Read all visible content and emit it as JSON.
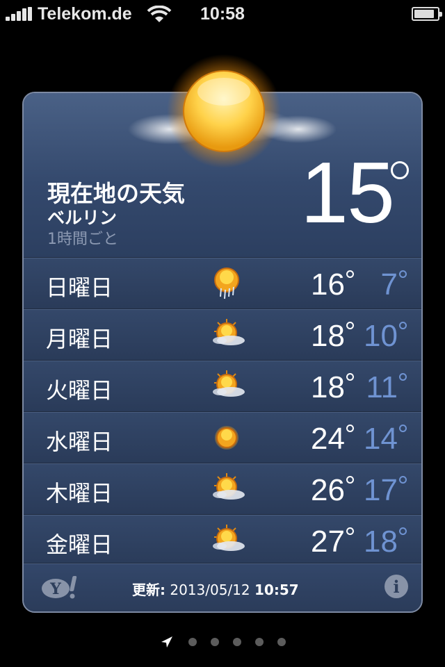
{
  "status_bar": {
    "carrier": "Telekom.de",
    "time": "10:58"
  },
  "current": {
    "title": "現在地の天気",
    "city": "ベルリン",
    "interval": "1時間ごと",
    "temperature": "15"
  },
  "forecast": [
    {
      "day": "日曜日",
      "icon": "sun-rain-icon",
      "high": "16",
      "low": "7"
    },
    {
      "day": "月曜日",
      "icon": "sun-cloud-icon",
      "high": "18",
      "low": "10"
    },
    {
      "day": "火曜日",
      "icon": "sun-cloud-icon",
      "high": "18",
      "low": "11"
    },
    {
      "day": "水曜日",
      "icon": "sun-icon",
      "high": "24",
      "low": "14"
    },
    {
      "day": "木曜日",
      "icon": "sun-cloud-icon",
      "high": "26",
      "low": "17"
    },
    {
      "day": "金曜日",
      "icon": "sun-cloud-icon",
      "high": "27",
      "low": "18"
    }
  ],
  "footer": {
    "updated_label": "更新:",
    "updated_date": "2013/05/12",
    "updated_time": "10:57",
    "info_label": "i"
  },
  "pager": {
    "page_count": 6,
    "current_page": 1
  },
  "colors": {
    "low_temp": "#6f93d2",
    "card": "#2f4262"
  }
}
